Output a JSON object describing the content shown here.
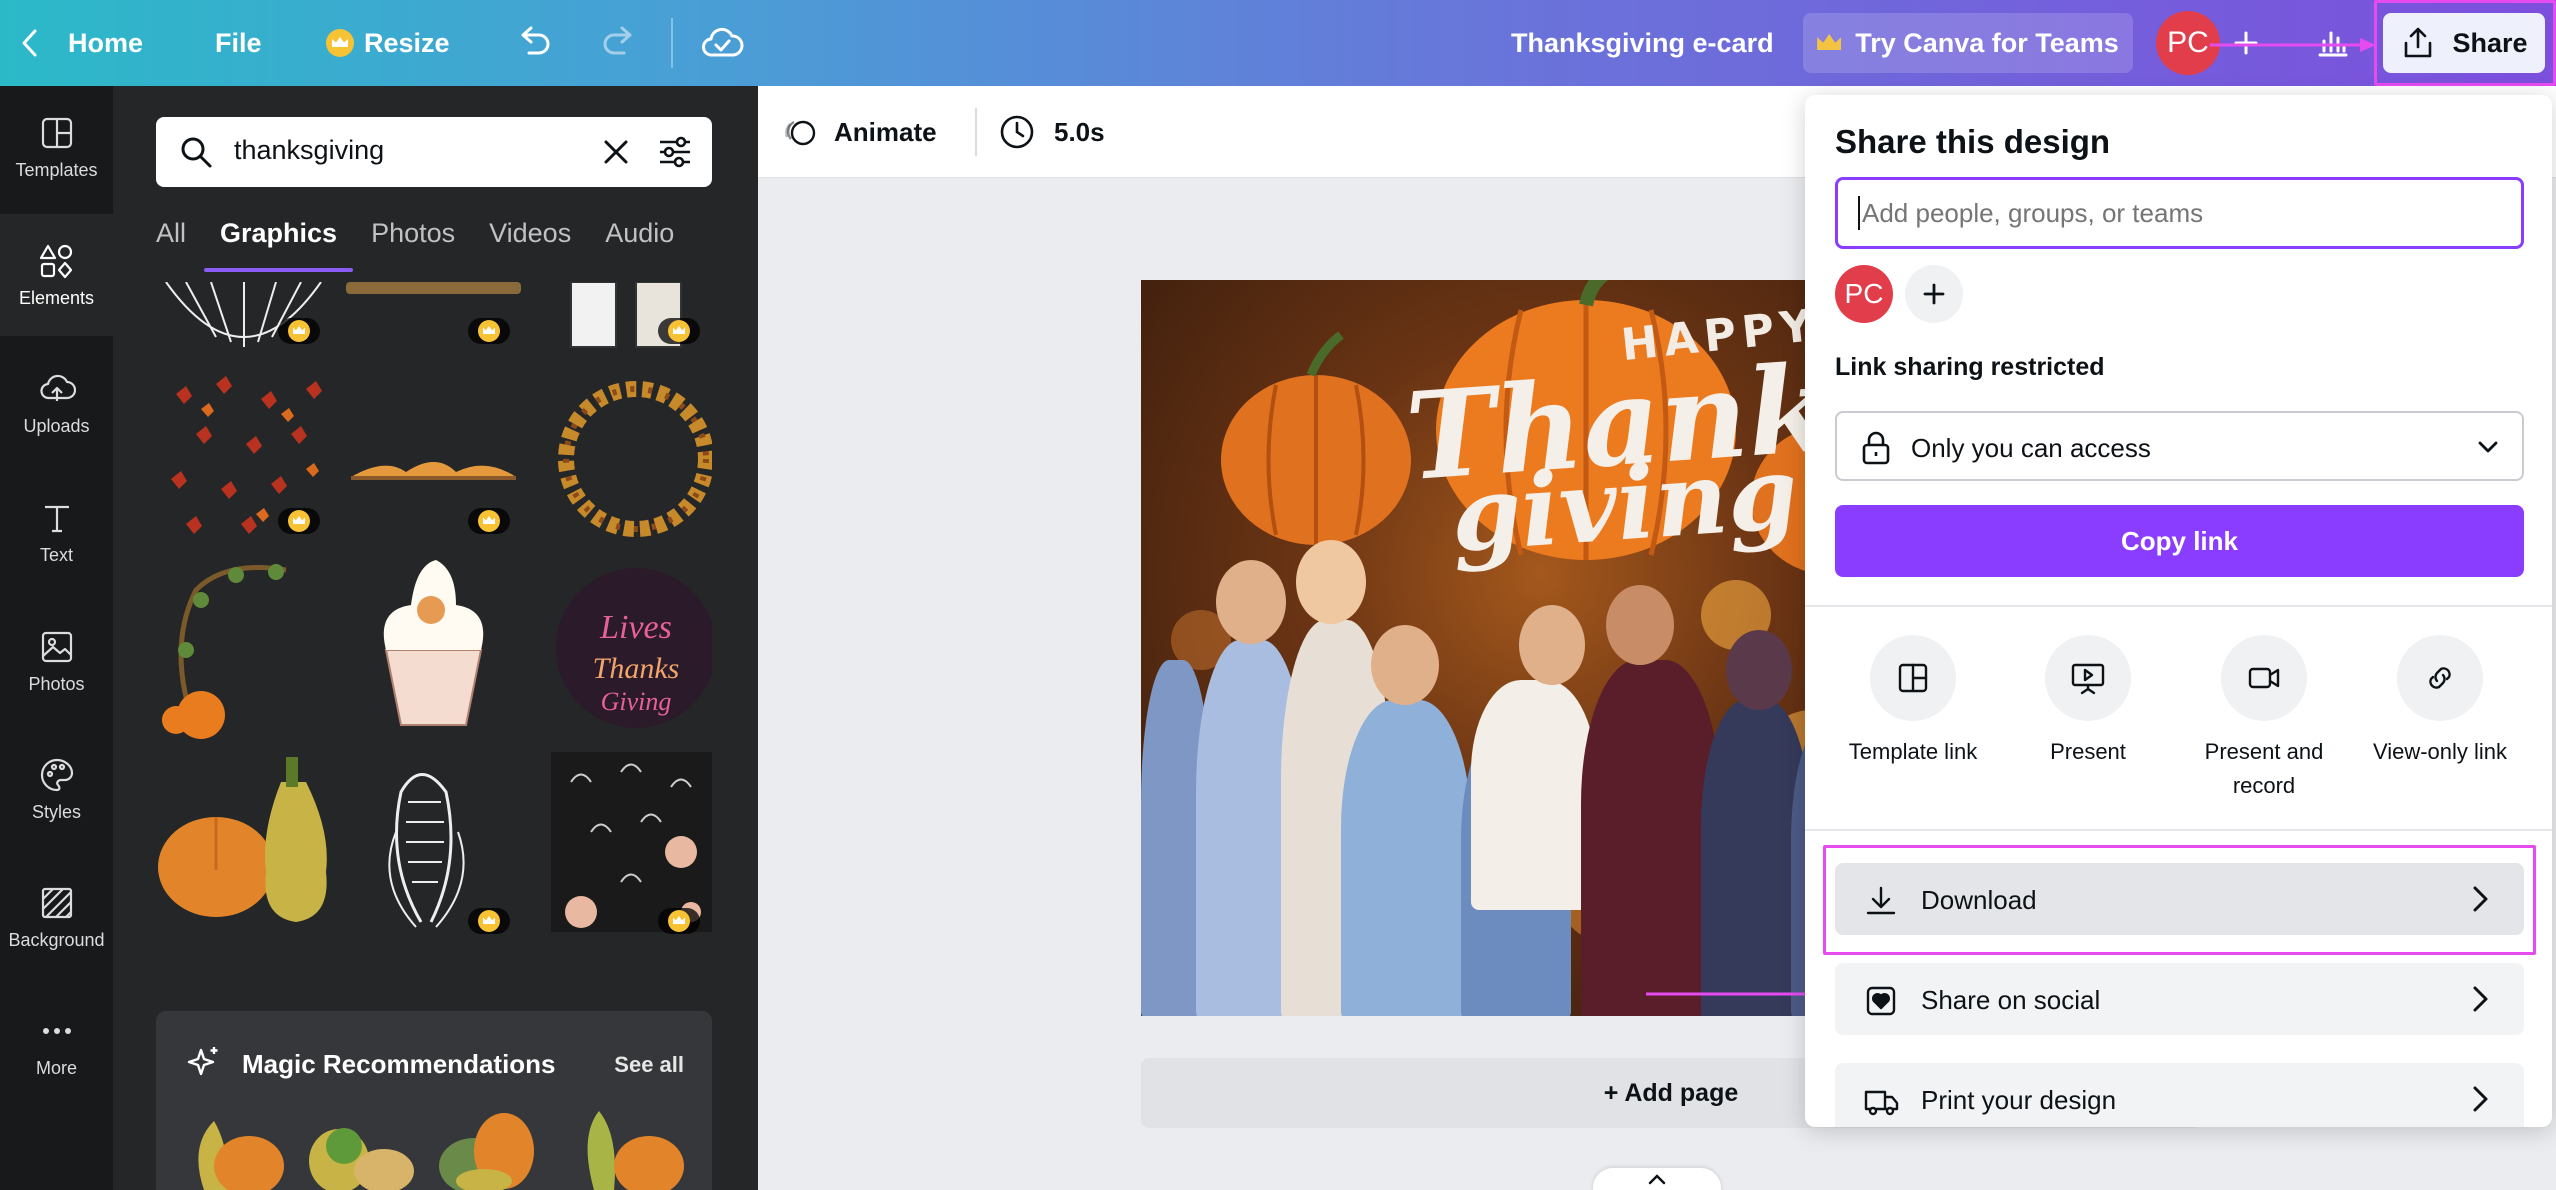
{
  "topbar": {
    "home_label": "Home",
    "file_label": "File",
    "resize_label": "Resize",
    "design_title": "Thanksgiving e-card",
    "teams_label": "Try Canva for Teams",
    "avatar_initials": "PC",
    "share_label": "Share"
  },
  "rail": {
    "items": [
      {
        "label": "Templates",
        "icon": "templates-icon"
      },
      {
        "label": "Elements",
        "icon": "elements-icon"
      },
      {
        "label": "Uploads",
        "icon": "uploads-icon"
      },
      {
        "label": "Text",
        "icon": "text-icon"
      },
      {
        "label": "Photos",
        "icon": "photos-icon"
      },
      {
        "label": "Styles",
        "icon": "styles-icon"
      },
      {
        "label": "Background",
        "icon": "background-icon"
      },
      {
        "label": "More",
        "icon": "more-icon"
      }
    ],
    "active": "Elements"
  },
  "panel": {
    "search_value": "thanksgiving",
    "tabs": [
      "All",
      "Graphics",
      "Photos",
      "Videos",
      "Audio"
    ],
    "active_tab": "Graphics",
    "magic_title": "Magic Recommendations",
    "see_all_label": "See all"
  },
  "toolbar": {
    "animate_label": "Animate",
    "duration": "5.0s"
  },
  "card_text": {
    "happy": "HAPPY",
    "line1": "Thanks",
    "line2": "giving"
  },
  "canvas": {
    "add_page_label": "+ Add page"
  },
  "share": {
    "title": "Share this design",
    "input_placeholder": "Add people, groups, or teams",
    "member_initials": "PC",
    "link_section_label": "Link sharing restricted",
    "access_value": "Only you can access",
    "copy_link_label": "Copy link",
    "options": [
      {
        "label": "Template link",
        "icon": "template-link-icon"
      },
      {
        "label": "Present",
        "icon": "present-icon"
      },
      {
        "label": "Present and record",
        "icon": "present-record-icon"
      },
      {
        "label": "View-only link",
        "icon": "view-only-link-icon"
      }
    ],
    "rows": [
      {
        "label": "Download",
        "icon": "download-icon"
      },
      {
        "label": "Share on social",
        "icon": "share-social-icon"
      },
      {
        "label": "Print your design",
        "icon": "print-truck-icon"
      }
    ]
  },
  "colors": {
    "accent_purple": "#8b3dff",
    "highlight_magenta": "#e64bf0",
    "avatar_red": "#e23d4a",
    "rail_bg": "#18191b",
    "panel_bg": "#252627"
  }
}
